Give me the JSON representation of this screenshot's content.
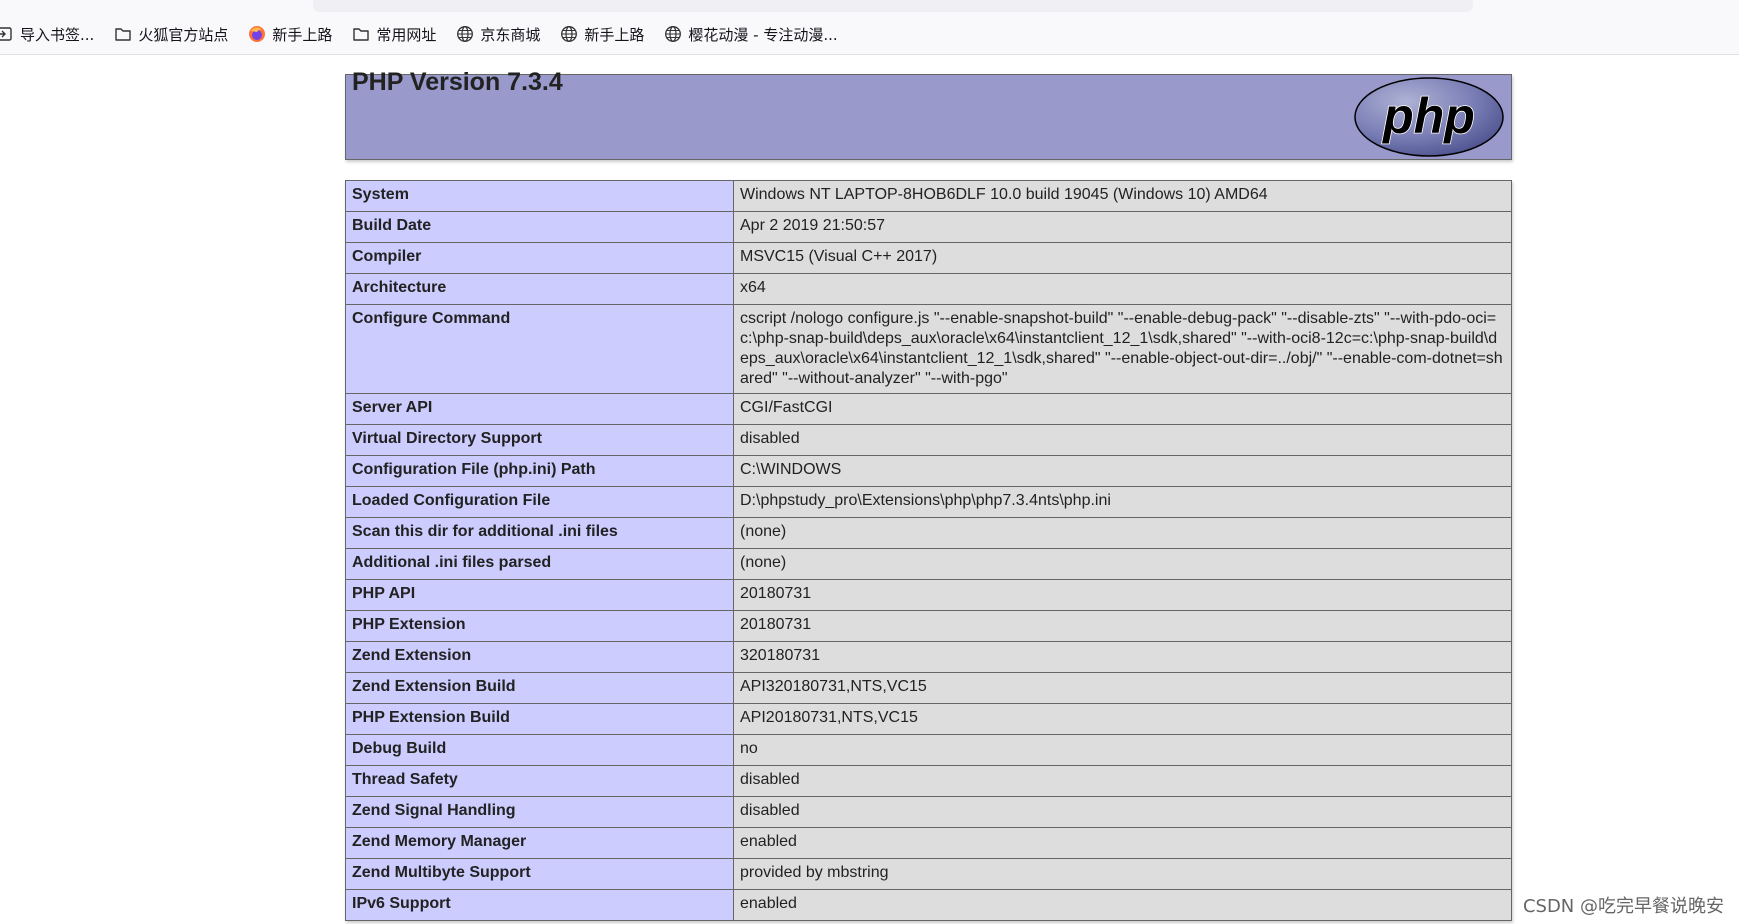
{
  "bookmarks": [
    {
      "label": "导入书签...",
      "icon": "import-icon"
    },
    {
      "label": "火狐官方站点",
      "icon": "folder-icon"
    },
    {
      "label": "新手上路",
      "icon": "firefox-icon"
    },
    {
      "label": "常用网址",
      "icon": "folder-icon"
    },
    {
      "label": "京东商城",
      "icon": "globe-icon"
    },
    {
      "label": "新手上路",
      "icon": "globe-icon"
    },
    {
      "label": "樱花动漫 - 专注动漫...",
      "icon": "globe-icon"
    }
  ],
  "header": {
    "title": "PHP Version 7.3.4",
    "logo_text": "php",
    "bg_color": "#9999cc"
  },
  "rows": [
    {
      "key": "System",
      "value": "Windows NT LAPTOP-8HOB6DLF 10.0 build 19045 (Windows 10) AMD64"
    },
    {
      "key": "Build Date",
      "value": "Apr 2 2019 21:50:57"
    },
    {
      "key": "Compiler",
      "value": "MSVC15 (Visual C++ 2017)"
    },
    {
      "key": "Architecture",
      "value": "x64"
    },
    {
      "key": "Configure Command",
      "value": "cscript /nologo configure.js \"--enable-snapshot-build\" \"--enable-debug-pack\" \"--disable-zts\" \"--with-pdo-oci=c:\\php-snap-build\\deps_aux\\oracle\\x64\\instantclient_12_1\\sdk,shared\" \"--with-oci8-12c=c:\\php-snap-build\\deps_aux\\oracle\\x64\\instantclient_12_1\\sdk,shared\" \"--enable-object-out-dir=../obj/\" \"--enable-com-dotnet=shared\" \"--without-analyzer\" \"--with-pgo\""
    },
    {
      "key": "Server API",
      "value": "CGI/FastCGI"
    },
    {
      "key": "Virtual Directory Support",
      "value": "disabled"
    },
    {
      "key": "Configuration File (php.ini) Path",
      "value": "C:\\WINDOWS"
    },
    {
      "key": "Loaded Configuration File",
      "value": "D:\\phpstudy_pro\\Extensions\\php\\php7.3.4nts\\php.ini"
    },
    {
      "key": "Scan this dir for additional .ini files",
      "value": "(none)"
    },
    {
      "key": "Additional .ini files parsed",
      "value": "(none)"
    },
    {
      "key": "PHP API",
      "value": "20180731"
    },
    {
      "key": "PHP Extension",
      "value": "20180731"
    },
    {
      "key": "Zend Extension",
      "value": "320180731"
    },
    {
      "key": "Zend Extension Build",
      "value": "API320180731,NTS,VC15"
    },
    {
      "key": "PHP Extension Build",
      "value": "API20180731,NTS,VC15"
    },
    {
      "key": "Debug Build",
      "value": "no"
    },
    {
      "key": "Thread Safety",
      "value": "disabled"
    },
    {
      "key": "Zend Signal Handling",
      "value": "disabled"
    },
    {
      "key": "Zend Memory Manager",
      "value": "enabled"
    },
    {
      "key": "Zend Multibyte Support",
      "value": "provided by mbstring"
    },
    {
      "key": "IPv6 Support",
      "value": "enabled"
    }
  ],
  "colors": {
    "key_bg": "#ccccff",
    "value_bg": "#dddddd"
  },
  "watermark": "CSDN @吃完早餐说晚安"
}
